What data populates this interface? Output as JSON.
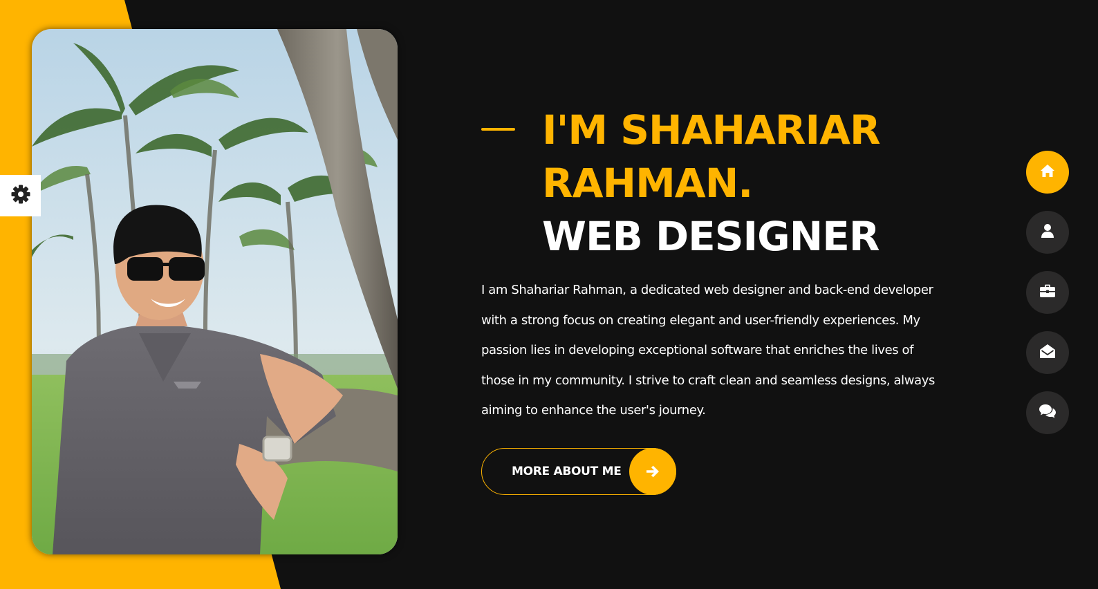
{
  "theme": {
    "accent": "#ffb400",
    "background": "#111111",
    "text": "#ffffff",
    "nav_button": "#2b2a2a"
  },
  "settings": {
    "icon": "gear-icon"
  },
  "hero": {
    "photo_alt": "Portrait of a smiling man in sunglasses and a grey polo shirt leaning on a tree trunk with palm trees behind",
    "title_line1": "I'M SHAHARIAR",
    "title_line2": "RAHMAN.",
    "title_line3": "WEB DESIGNER",
    "bio": "I am Shahariar Rahman, a dedicated web designer and back-end developer with a strong focus on creating elegant and user-friendly experiences. My passion lies in developing exceptional software that enriches the lives of those in my community. I strive to craft clean and seamless designs, always aiming to enhance the user's journey.",
    "button_label": "MORE ABOUT ME",
    "button_icon": "arrow-right-icon"
  },
  "side_nav": {
    "items": [
      {
        "id": "home",
        "icon": "home-icon",
        "active": true
      },
      {
        "id": "about",
        "icon": "user-icon",
        "active": false
      },
      {
        "id": "portfolio",
        "icon": "briefcase-icon",
        "active": false
      },
      {
        "id": "contact",
        "icon": "envelope-open-icon",
        "active": false
      },
      {
        "id": "blog",
        "icon": "comments-icon",
        "active": false
      }
    ]
  }
}
